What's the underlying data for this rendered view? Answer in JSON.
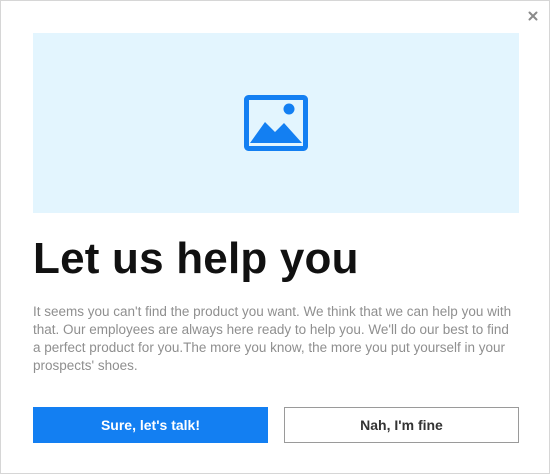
{
  "dialog": {
    "close_icon": "close-icon",
    "image_icon": "image-placeholder-icon",
    "title": "Let us help you",
    "message": "It seems you can't find the product you want. We think that we can help you with that. Our employees are always here ready to help you. We'll do our best to find a perfect product for you.The more you know, the more you put yourself in your prospects' shoes.",
    "primary_button_label": "Sure, let's talk!",
    "secondary_button_label": "Nah, I'm fine"
  },
  "colors": {
    "accent": "#137ff2",
    "hero_background": "#e3f5fe",
    "title": "#111111",
    "body_text": "#8f8f8f"
  }
}
